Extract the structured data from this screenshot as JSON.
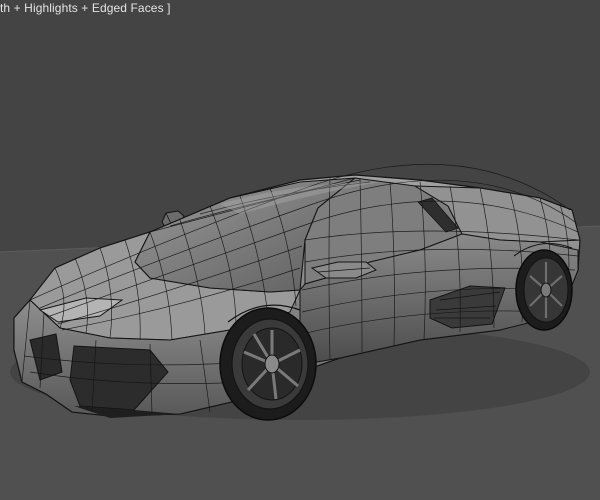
{
  "viewport": {
    "shading_label": "th + Highlights + Edged Faces ]",
    "background_color": "#444444",
    "ground_color": "#505050",
    "mesh_fill_color": "#8c8c8c",
    "wire_color": "#141414",
    "highlight_color": "#b4b4b4",
    "shadow_color": "#2a2a2a"
  }
}
